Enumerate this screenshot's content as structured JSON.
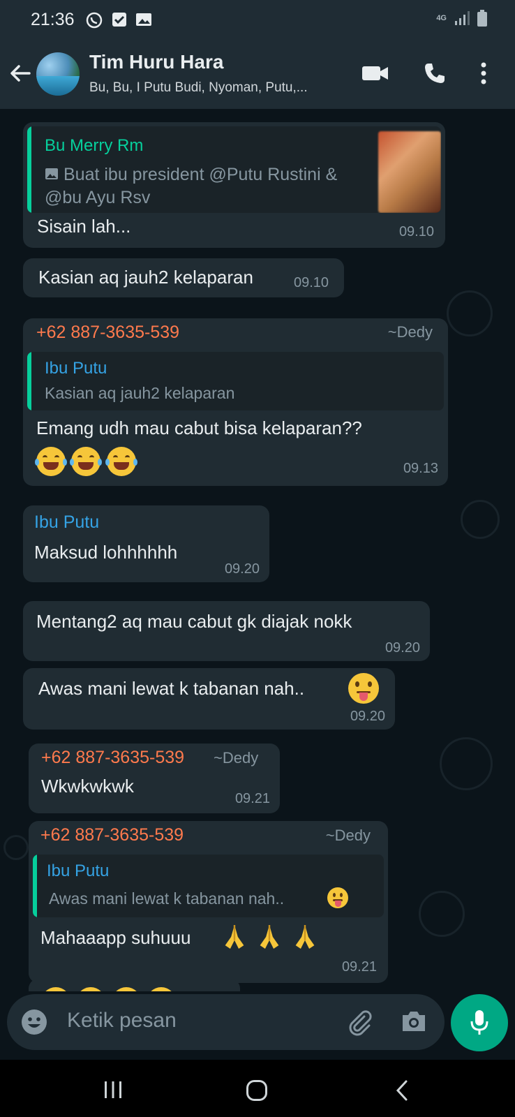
{
  "status_bar": {
    "time": "21:36",
    "network": "4G"
  },
  "header": {
    "title": "Tim Huru Hara",
    "subtitle": "Bu, Bu, I Putu Budi, Nyoman, Putu,..."
  },
  "messages": [
    {
      "quote": {
        "name": "Bu Merry Rm",
        "line1": "Buat ibu president @Putu Rustini &",
        "line2": "@bu Ayu Rsv"
      },
      "text": "Sisain lah...",
      "time": "09.10"
    },
    {
      "text": "Kasian aq jauh2 kelaparan",
      "time": "09.10"
    },
    {
      "sender": "+62 887-3635-539",
      "alias": "~Dedy",
      "quote": {
        "name": "Ibu Putu",
        "text": "Kasian aq jauh2 kelaparan"
      },
      "text": "Emang udh mau cabut bisa kelaparan??",
      "time": "09.13"
    },
    {
      "sender": "Ibu Putu",
      "text": "Maksud lohhhhhh",
      "time": "09.20"
    },
    {
      "text": "Mentang2 aq mau cabut gk diajak nokk",
      "time": "09.20"
    },
    {
      "text": "Awas mani lewat k tabanan nah..",
      "time": "09.20"
    },
    {
      "sender": "+62 887-3635-539",
      "alias": "~Dedy",
      "text": "Wkwkwkwk",
      "time": "09.21"
    },
    {
      "sender": "+62 887-3635-539",
      "alias": "~Dedy",
      "quote": {
        "name": "Ibu Putu",
        "text": "Awas mani lewat k tabanan nah.."
      },
      "text": "Mahaaapp suhuuu",
      "time": "09.21"
    }
  ],
  "input": {
    "placeholder": "Ketik pesan"
  },
  "colors": {
    "accent": "#00a884",
    "sender_phone": "#ff7a4d",
    "sender_named": "#35a3e5",
    "quote_bar_green": "#06cf9c",
    "bubble": "#202c33"
  },
  "icons": [
    "back-arrow-icon",
    "video-call-icon",
    "voice-call-icon",
    "more-options-icon",
    "emoji-icon",
    "attach-icon",
    "camera-icon",
    "mic-icon",
    "recents-icon",
    "home-icon",
    "back-nav-icon"
  ]
}
